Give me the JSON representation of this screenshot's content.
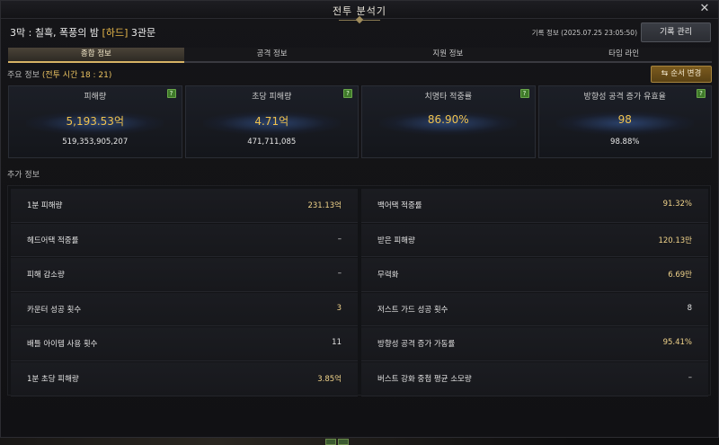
{
  "window": {
    "title": "전투 분석기",
    "close_glyph": "✕"
  },
  "header": {
    "stage_prefix": "3막 : 칠흑, 폭풍의 밤 ",
    "difficulty": "[하드]",
    "stage_suffix": " 3관문",
    "record_info": "기록 정보 (2025.07.25 23:05:50)",
    "record_button": "기록 관리"
  },
  "tabs": [
    {
      "label": "종합 정보",
      "active": true
    },
    {
      "label": "공격 정보",
      "active": false
    },
    {
      "label": "지원 정보",
      "active": false
    },
    {
      "label": "타임 라인",
      "active": false
    }
  ],
  "main_info": {
    "label": "주요 정보",
    "battle_time": "(전투 시간 18 : 21)",
    "order_button": "순서 변경",
    "order_icon": "⇆",
    "help_glyph": "?"
  },
  "cards": [
    {
      "caption": "피해량",
      "main": "5,193.53억",
      "sub": "519,353,905,207"
    },
    {
      "caption": "초당 피해량",
      "main": "4.71억",
      "sub": "471,711,085"
    },
    {
      "caption": "치명타 적중률",
      "main": "86.90%",
      "sub": ""
    },
    {
      "caption": "방향성 공격 증가 유효율",
      "main": "98",
      "sub": "98.88%"
    }
  ],
  "extra_info": {
    "label": "추가 정보",
    "rows": [
      {
        "label": "1분 피해량",
        "value": "231.13억"
      },
      {
        "label": "백어택 적중률",
        "value": "91.32%"
      },
      {
        "label": "헤드어택 적중률",
        "value": "–"
      },
      {
        "label": "받은 피해량",
        "value": "120.13만"
      },
      {
        "label": "피해 감소량",
        "value": "–"
      },
      {
        "label": "무력화",
        "value": "6.69만"
      },
      {
        "label": "카운터 성공 횟수",
        "value": "3"
      },
      {
        "label": "저스트 가드 성공 횟수",
        "value": "8"
      },
      {
        "label": "배틀 아이템 사용 횟수",
        "value": "11"
      },
      {
        "label": "방향성 공격 증가 가동률",
        "value": "95.41%"
      },
      {
        "label": "1분 초당 피해량",
        "value": "3.85억"
      },
      {
        "label": "버스트 강화 중첩 평균 소모량",
        "value": "–"
      }
    ]
  },
  "colors": {
    "accent_gold": "#f0c24e",
    "difficulty": "#e8b84a",
    "tab_active_border": "#d7b365"
  }
}
